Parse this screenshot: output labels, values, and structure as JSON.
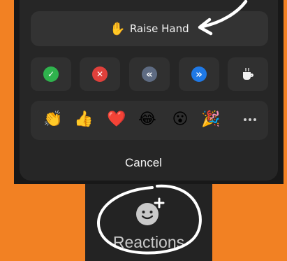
{
  "reaction_sheet": {
    "raise_hand_emoji": "✋",
    "raise_hand_label": "Raise Hand",
    "status_buttons": [
      {
        "icon": "check-icon",
        "glyph": "✓",
        "color": "#2fb34d"
      },
      {
        "icon": "x-icon",
        "glyph": "✕",
        "color": "#e0403b"
      },
      {
        "icon": "slower-icon",
        "glyph": "«",
        "color": "#5e6b82"
      },
      {
        "icon": "faster-icon",
        "glyph": "»",
        "color": "#1f79e6"
      },
      {
        "icon": "coffee-icon",
        "glyph": "",
        "color": "#f1f1f1"
      }
    ],
    "emojis": [
      "👏",
      "👍",
      "❤️",
      "😂",
      "😮",
      "🎉"
    ],
    "more_icon": "more-horizontal-icon",
    "cancel_label": "Cancel"
  },
  "toolbar": {
    "reactions_label": "Reactions",
    "reactions_icon": "add-reaction-icon"
  },
  "colors": {
    "background": "#f28123",
    "panel": "#262626",
    "annotation": "#ffffff"
  }
}
